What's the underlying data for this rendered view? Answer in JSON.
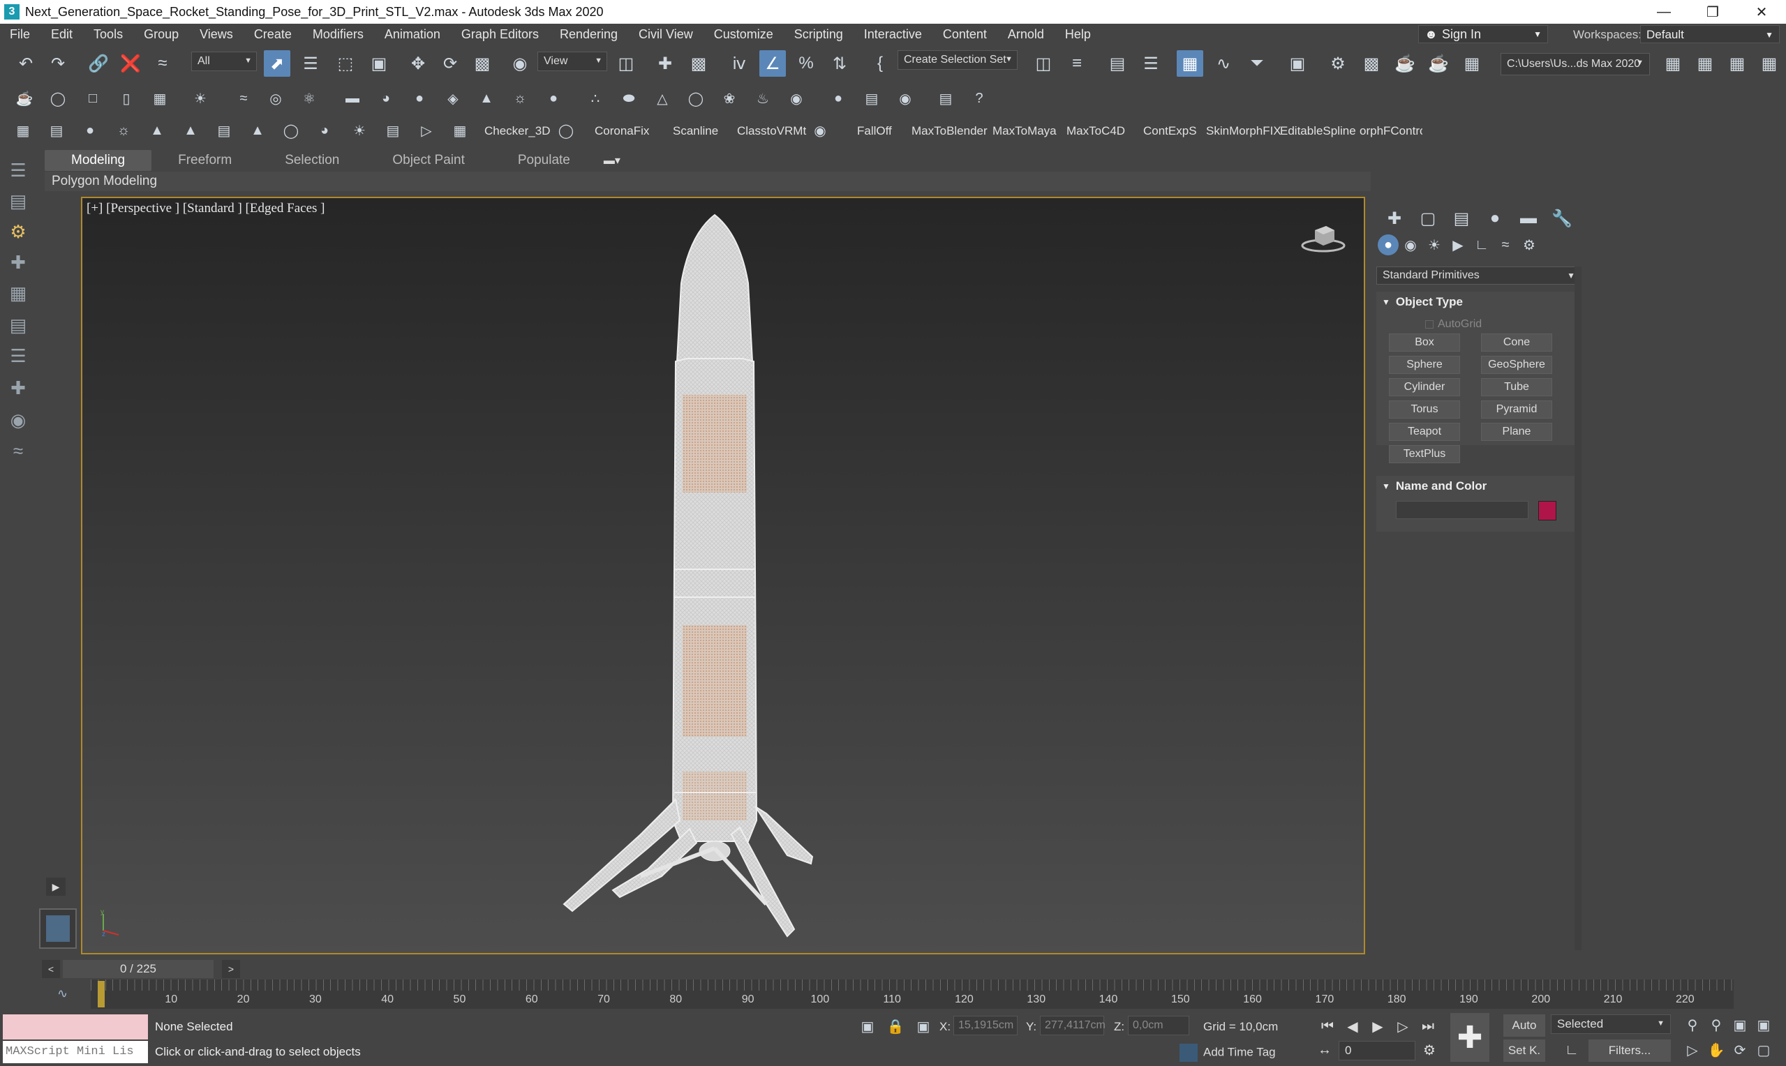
{
  "window": {
    "title": "Next_Generation_Space_Rocket_Standing_Pose_for_3D_Print_STL_V2.max - Autodesk 3ds Max 2020",
    "app_icon": "3",
    "minimize": "—",
    "restore": "❐",
    "close": "✕"
  },
  "menu": [
    "File",
    "Edit",
    "Tools",
    "Group",
    "Views",
    "Create",
    "Modifiers",
    "Animation",
    "Graph Editors",
    "Rendering",
    "Civil View",
    "Customize",
    "Scripting",
    "Interactive",
    "Content",
    "Arnold",
    "Help"
  ],
  "signin": {
    "label": "Sign In"
  },
  "workspaces": {
    "label": "Workspaces:",
    "value": "Default"
  },
  "toolbar": {
    "selection_filter": "All",
    "ref_coord": "View",
    "selection_set": "Create Selection Set",
    "project_path": "C:\\Users\\Us...ds Max 2020"
  },
  "plugins": [
    "Checker_3D",
    "CoronaFix",
    "Scanline",
    "ClasstoVRMt",
    "FallOff",
    "MaxToBlender",
    "MaxToMaya",
    "MaxToC4D",
    "ContExpS",
    "SkinMorphFIX",
    "EditableSpline",
    "orphFControll"
  ],
  "ribbon": {
    "tabs": [
      "Modeling",
      "Freeform",
      "Selection",
      "Object Paint",
      "Populate"
    ],
    "active_tab": "Modeling",
    "panel_label": "Polygon Modeling"
  },
  "viewport": {
    "label": "[+] [Perspective ] [Standard ] [Edged Faces ]"
  },
  "command_panel": {
    "category": "Standard Primitives",
    "object_type": {
      "title": "Object Type",
      "autogrid": "AutoGrid",
      "buttons": [
        "Box",
        "Cone",
        "Sphere",
        "GeoSphere",
        "Cylinder",
        "Tube",
        "Torus",
        "Pyramid",
        "Teapot",
        "Plane",
        "TextPlus"
      ]
    },
    "name_and_color": {
      "title": "Name and Color",
      "name_value": "",
      "color": "#b0154a"
    }
  },
  "timeslider": {
    "frame": "0 / 225",
    "prev": "<",
    "next": ">"
  },
  "trackbar": {
    "ticks": [
      "10",
      "20",
      "30",
      "40",
      "50",
      "60",
      "70",
      "80",
      "90",
      "100",
      "110",
      "120",
      "130",
      "140",
      "150",
      "160",
      "170",
      "180",
      "190",
      "200",
      "210",
      "220"
    ]
  },
  "status": {
    "maxscript": "MAXScript Mini Lis",
    "selection": "None Selected",
    "prompt": "Click or click-and-drag to select objects",
    "x_label": "X:",
    "x_value": "15,1915cm",
    "y_label": "Y:",
    "y_value": "277,4117cm",
    "z_label": "Z:",
    "z_value": "0,0cm",
    "grid": "Grid = 10,0cm",
    "add_time_tag": "Add Time Tag",
    "frame_field": "0",
    "auto": "Auto",
    "set_key": "Set K.",
    "selected_dd": "Selected",
    "filters": "Filters..."
  },
  "colors": {
    "accent": "#5b87b8",
    "viewport_border": "#b08a2a",
    "time_cursor": "#b99b34",
    "maxscript_bg": "#f2c9cf"
  }
}
